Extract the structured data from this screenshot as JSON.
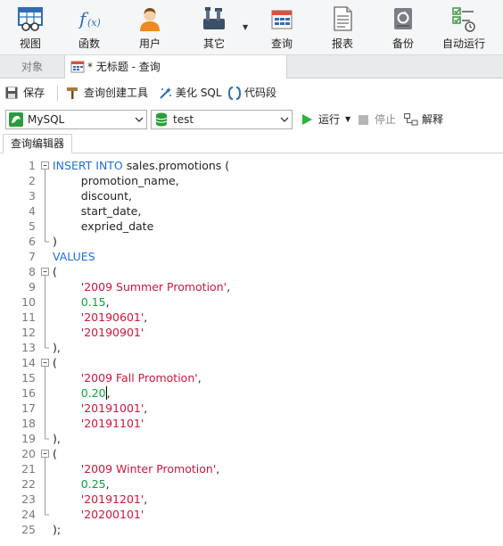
{
  "toolbar": {
    "items": [
      {
        "label": "视图",
        "icon": "view-icon"
      },
      {
        "label": "函数",
        "icon": "function-icon"
      },
      {
        "label": "用户",
        "icon": "user-icon"
      },
      {
        "label": "其它",
        "icon": "tools-icon"
      },
      {
        "label": "查询",
        "icon": "query-icon"
      },
      {
        "label": "报表",
        "icon": "report-icon"
      },
      {
        "label": "备份",
        "icon": "backup-icon"
      },
      {
        "label": "自动运行",
        "icon": "automation-icon"
      }
    ]
  },
  "tabs": {
    "objects_label": "对象",
    "query_label": "* 无标题 - 查询"
  },
  "actions": {
    "save": "保存",
    "query_builder": "查询创建工具",
    "beautify": "美化 SQL",
    "snippet": "代码段"
  },
  "connection": {
    "server_value": "MySQL",
    "database_value": "test",
    "run": "运行",
    "stop": "停止",
    "explain": "解释"
  },
  "editor_tab": "查询编辑器",
  "colors": {
    "keyword": "#1e6fd6",
    "string": "#d0153c",
    "number": "#0aa33d"
  },
  "code_lines": [
    {
      "n": "1",
      "parts": [
        {
          "t": "INSERT INTO",
          "c": "kw"
        },
        {
          "t": " sales.promotions (",
          "c": "plain"
        }
      ],
      "fold": "open"
    },
    {
      "n": "2",
      "parts": [
        {
          "t": "        promotion_name,",
          "c": "plain"
        }
      ],
      "fold": "line"
    },
    {
      "n": "3",
      "parts": [
        {
          "t": "        discount,",
          "c": "plain"
        }
      ],
      "fold": "line"
    },
    {
      "n": "4",
      "parts": [
        {
          "t": "        start_date,",
          "c": "plain"
        }
      ],
      "fold": "line"
    },
    {
      "n": "5",
      "parts": [
        {
          "t": "        expried_date",
          "c": "plain"
        }
      ],
      "fold": "line"
    },
    {
      "n": "6",
      "parts": [
        {
          "t": ")",
          "c": "plain"
        }
      ],
      "fold": "end"
    },
    {
      "n": "7",
      "parts": [
        {
          "t": "VALUES",
          "c": "kw"
        }
      ],
      "fold": "none"
    },
    {
      "n": "8",
      "parts": [
        {
          "t": "(",
          "c": "plain"
        }
      ],
      "fold": "open"
    },
    {
      "n": "9",
      "parts": [
        {
          "t": "        ",
          "c": "plain"
        },
        {
          "t": "'2009 Summer Promotion'",
          "c": "str"
        },
        {
          "t": ",",
          "c": "plain"
        }
      ],
      "fold": "line"
    },
    {
      "n": "10",
      "parts": [
        {
          "t": "        ",
          "c": "plain"
        },
        {
          "t": "0.15",
          "c": "num"
        },
        {
          "t": ",",
          "c": "plain"
        }
      ],
      "fold": "line"
    },
    {
      "n": "11",
      "parts": [
        {
          "t": "        ",
          "c": "plain"
        },
        {
          "t": "'20190601'",
          "c": "str"
        },
        {
          "t": ",",
          "c": "plain"
        }
      ],
      "fold": "line"
    },
    {
      "n": "12",
      "parts": [
        {
          "t": "        ",
          "c": "plain"
        },
        {
          "t": "'20190901'",
          "c": "str"
        }
      ],
      "fold": "line"
    },
    {
      "n": "13",
      "parts": [
        {
          "t": "),",
          "c": "plain"
        }
      ],
      "fold": "end"
    },
    {
      "n": "14",
      "parts": [
        {
          "t": "(",
          "c": "plain"
        }
      ],
      "fold": "open"
    },
    {
      "n": "15",
      "parts": [
        {
          "t": "        ",
          "c": "plain"
        },
        {
          "t": "'2009 Fall Promotion'",
          "c": "str"
        },
        {
          "t": ",",
          "c": "plain"
        }
      ],
      "fold": "line"
    },
    {
      "n": "16",
      "parts": [
        {
          "t": "        ",
          "c": "plain"
        },
        {
          "t": "0.20",
          "c": "num"
        },
        {
          "t": ",",
          "c": "plain"
        }
      ],
      "fold": "line",
      "caret": true
    },
    {
      "n": "17",
      "parts": [
        {
          "t": "        ",
          "c": "plain"
        },
        {
          "t": "'20191001'",
          "c": "str"
        },
        {
          "t": ",",
          "c": "plain"
        }
      ],
      "fold": "line"
    },
    {
      "n": "18",
      "parts": [
        {
          "t": "        ",
          "c": "plain"
        },
        {
          "t": "'20191101'",
          "c": "str"
        }
      ],
      "fold": "line"
    },
    {
      "n": "19",
      "parts": [
        {
          "t": "),",
          "c": "plain"
        }
      ],
      "fold": "end"
    },
    {
      "n": "20",
      "parts": [
        {
          "t": "(",
          "c": "plain"
        }
      ],
      "fold": "open"
    },
    {
      "n": "21",
      "parts": [
        {
          "t": "        ",
          "c": "plain"
        },
        {
          "t": "'2009 Winter Promotion'",
          "c": "str"
        },
        {
          "t": ",",
          "c": "plain"
        }
      ],
      "fold": "line"
    },
    {
      "n": "22",
      "parts": [
        {
          "t": "        ",
          "c": "plain"
        },
        {
          "t": "0.25",
          "c": "num"
        },
        {
          "t": ",",
          "c": "plain"
        }
      ],
      "fold": "line"
    },
    {
      "n": "23",
      "parts": [
        {
          "t": "        ",
          "c": "plain"
        },
        {
          "t": "'20191201'",
          "c": "str"
        },
        {
          "t": ",",
          "c": "plain"
        }
      ],
      "fold": "line"
    },
    {
      "n": "24",
      "parts": [
        {
          "t": "        ",
          "c": "plain"
        },
        {
          "t": "'20200101'",
          "c": "str"
        }
      ],
      "fold": "end"
    },
    {
      "n": "25",
      "parts": [
        {
          "t": ");",
          "c": "plain"
        }
      ],
      "fold": "none"
    }
  ]
}
